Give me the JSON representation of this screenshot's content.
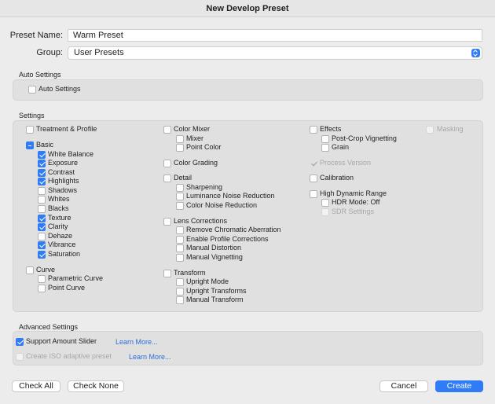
{
  "window": {
    "title": "New Develop Preset"
  },
  "preset_name": {
    "label": "Preset Name:",
    "value": "Warm Preset"
  },
  "group": {
    "label": "Group:",
    "value": "User Presets"
  },
  "auto_settings": {
    "title": "Auto Settings",
    "auto_label": "Auto Settings"
  },
  "settings": {
    "title": "Settings",
    "treatment": "Treatment & Profile",
    "basic": "Basic",
    "white_balance": "White Balance",
    "exposure": "Exposure",
    "contrast": "Contrast",
    "highlights": "Highlights",
    "shadows": "Shadows",
    "whites": "Whites",
    "blacks": "Blacks",
    "texture": "Texture",
    "clarity": "Clarity",
    "dehaze": "Dehaze",
    "vibrance": "Vibrance",
    "saturation": "Saturation",
    "curve": "Curve",
    "parametric_curve": "Parametric Curve",
    "point_curve": "Point Curve",
    "color_mixer": "Color Mixer",
    "mixer": "Mixer",
    "point_color": "Point Color",
    "color_grading": "Color Grading",
    "detail": "Detail",
    "sharpening": "Sharpening",
    "luminance_nr": "Luminance Noise Reduction",
    "color_nr": "Color Noise Reduction",
    "lens_corrections": "Lens Corrections",
    "remove_ca": "Remove Chromatic Aberration",
    "enable_profile": "Enable Profile Corrections",
    "manual_distortion": "Manual Distortion",
    "manual_vignetting": "Manual Vignetting",
    "transform": "Transform",
    "upright_mode": "Upright Mode",
    "upright_transforms": "Upright Transforms",
    "manual_transform": "Manual Transform",
    "effects": "Effects",
    "post_crop": "Post-Crop Vignetting",
    "grain": "Grain",
    "masking": "Masking",
    "process_version": "Process Version",
    "calibration": "Calibration",
    "hdr": "High Dynamic Range",
    "hdr_mode": "HDR Mode: Off",
    "sdr_settings": "SDR Settings"
  },
  "advanced": {
    "title": "Advanced Settings",
    "support_amount": "Support Amount Slider",
    "learn_more_1": "Learn More...",
    "iso_adaptive": "Create ISO adaptive preset",
    "learn_more_2": "Learn More..."
  },
  "buttons": {
    "check_all": "Check All",
    "check_none": "Check None",
    "cancel": "Cancel",
    "create": "Create"
  },
  "colors": {
    "accent": "#2f7cf6",
    "link": "#2b6fd6"
  }
}
